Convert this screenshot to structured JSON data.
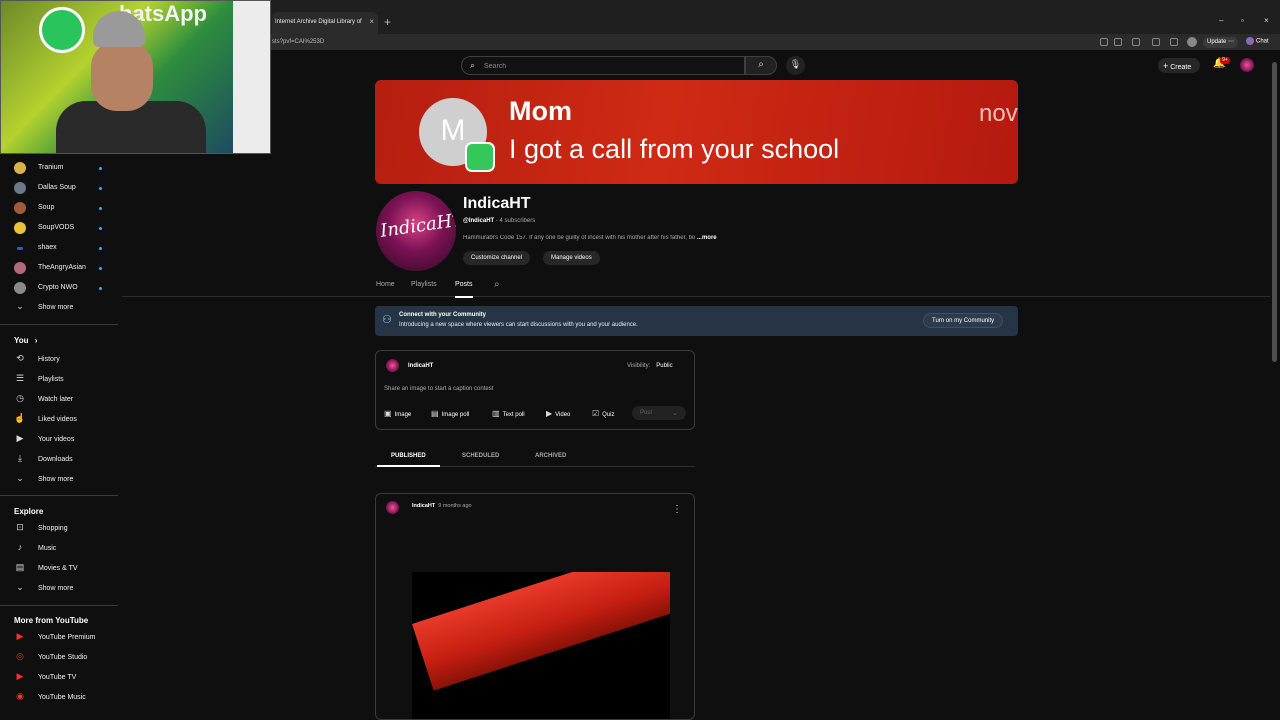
{
  "browser": {
    "tab_title": "Internet Archive Digital Library of",
    "tab_close": "×",
    "new_tab": "+",
    "url": "sts?pvf=CAI%253D",
    "update_label": "Update ⋯",
    "chat_label": "Chat",
    "minimize": "–",
    "restore": "▫",
    "close": "×"
  },
  "webcam": {
    "background_text": "hatsApp"
  },
  "topbar": {
    "search_placeholder": "Search",
    "create_label": "Create",
    "notification_count": "9+"
  },
  "notification": {
    "avatar_letter": "M",
    "sender": "Mom",
    "message": "I got a call from your school",
    "time": "nov"
  },
  "sidebar": {
    "subscriptions": [
      {
        "label": "Tranium",
        "color": "#d8b24a"
      },
      {
        "label": "Dallas Soup",
        "color": "#6b7a88"
      },
      {
        "label": "Soup",
        "color": "#a05a3c"
      },
      {
        "label": "SoupVODS",
        "color": "#e8c43a"
      },
      {
        "label": "shaex",
        "color": "#3a4ee8"
      },
      {
        "label": "TheAngryAsian",
        "color": "#b06a7a"
      },
      {
        "label": "Crypto NWO",
        "color": "#8a8a8a"
      }
    ],
    "show_more_1": "Show more",
    "you_heading": "You",
    "you_items": [
      {
        "label": "History",
        "icon": "history-icon"
      },
      {
        "label": "Playlists",
        "icon": "playlists-icon"
      },
      {
        "label": "Watch later",
        "icon": "clock-icon"
      },
      {
        "label": "Liked videos",
        "icon": "thumbs-up-icon"
      },
      {
        "label": "Your videos",
        "icon": "video-icon"
      },
      {
        "label": "Downloads",
        "icon": "download-icon"
      }
    ],
    "show_more_2": "Show more",
    "explore_heading": "Explore",
    "explore_items": [
      {
        "label": "Shopping",
        "icon": "shopping-bag-icon"
      },
      {
        "label": "Music",
        "icon": "music-note-icon"
      },
      {
        "label": "Movies & TV",
        "icon": "clapperboard-icon"
      }
    ],
    "show_more_3": "Show more",
    "more_heading": "More from YouTube",
    "more_items": [
      {
        "label": "YouTube Premium"
      },
      {
        "label": "YouTube Studio"
      },
      {
        "label": "YouTube TV"
      },
      {
        "label": "YouTube Music"
      }
    ]
  },
  "channel": {
    "avatar_text": "IndicaHT",
    "name": "IndicaHT",
    "handle": "@IndicaHT",
    "subscribers": "4 subscribers",
    "description": "Hammurabi's Code 157. If any one be guilty of incest with his mother after his father, bo",
    "more_label": "...more",
    "customize_label": "Customize channel",
    "manage_label": "Manage videos",
    "tabs": [
      "Home",
      "Playlists",
      "Posts"
    ]
  },
  "community": {
    "title": "Connect with your Community",
    "subtitle": "Introducing a new space where viewers can start discussions with you and your audience.",
    "button": "Turn on my Community"
  },
  "composer": {
    "name": "IndicaHT",
    "visibility_label": "Visibility:",
    "visibility_value": "Public",
    "prompt": "Share an image to start a caption contest",
    "buttons": [
      "Image",
      "Image poll",
      "Text poll",
      "Video",
      "Quiz"
    ],
    "post_label": "Post"
  },
  "post_tabs": [
    "PUBLISHED",
    "SCHEDULED",
    "ARCHIVED"
  ],
  "post": {
    "author": "IndicaHT",
    "time": "9 months ago"
  }
}
